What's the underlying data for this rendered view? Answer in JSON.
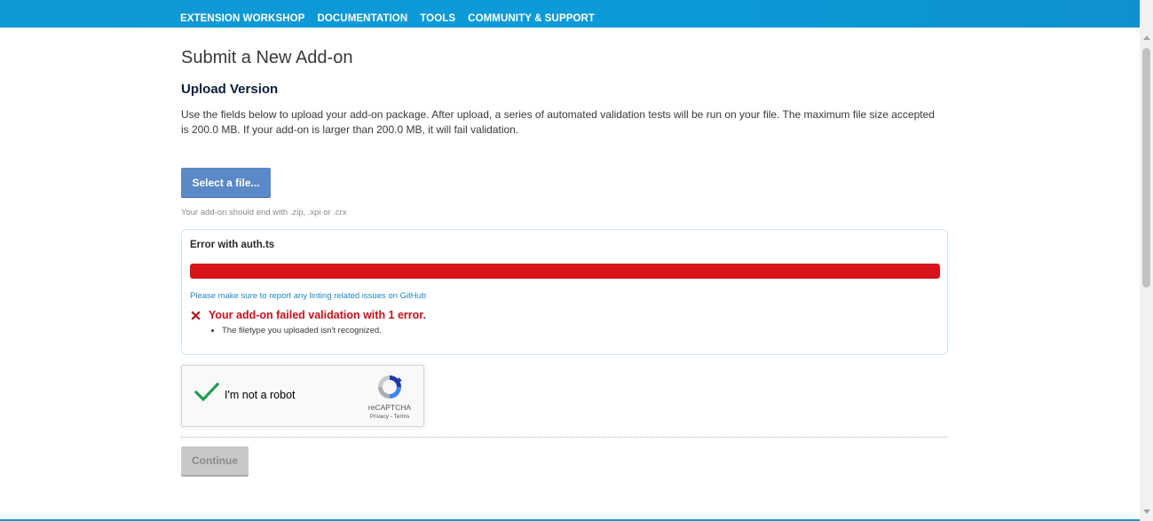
{
  "nav": {
    "items": [
      "EXTENSION WORKSHOP",
      "DOCUMENTATION",
      "TOOLS",
      "COMMUNITY & SUPPORT"
    ]
  },
  "page": {
    "title": "Submit a New Add-on",
    "section_title": "Upload Version",
    "description": "Use the fields below to upload your add-on package. After upload, a series of automated validation tests will be run on your file. The maximum file size accepted is 200.0 MB. If your add-on is larger than 200.0 MB, it will fail validation."
  },
  "upload": {
    "select_label": "Select a file...",
    "hint": "Your add-on should end with .zip, .xpi or .crx",
    "status_title": "Error with auth.ts",
    "progress_percent": 100,
    "progress_color": "#d7141a",
    "lint_link": "Please make sure to report any linting related issues on GitHub",
    "fail_message": "Your add-on failed validation with 1 error.",
    "errors": [
      "The filetype you uploaded isn't recognized."
    ],
    "fail_icon": "x-mark-icon"
  },
  "captcha": {
    "label": "I'm not a robot",
    "brand": "reCAPTCHA",
    "links": "Privacy - Terms",
    "checked": true
  },
  "actions": {
    "continue_label": "Continue"
  },
  "colors": {
    "header": "#0e98d6",
    "primary_button": "#5b89c7",
    "error": "#c6121a",
    "link": "#1f87c8",
    "disabled": "#c8c8c8"
  }
}
